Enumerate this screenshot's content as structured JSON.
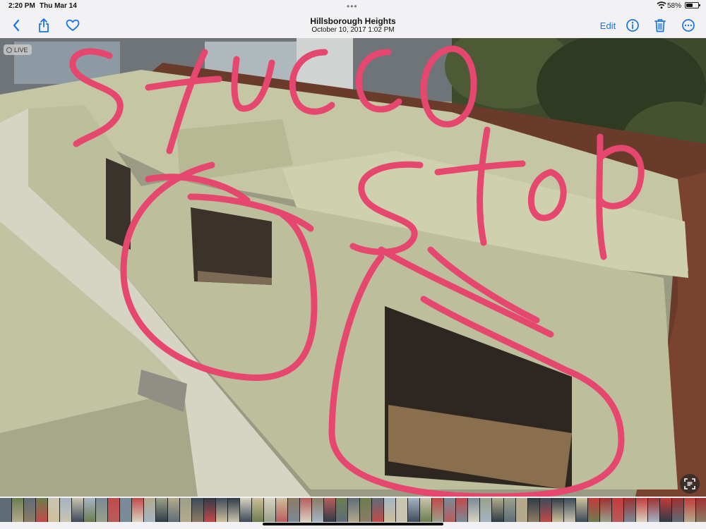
{
  "status_bar": {
    "time": "2:20 PM",
    "date": "Thu Mar 14",
    "battery_percent": "58%",
    "battery_level": 0.58
  },
  "nav": {
    "title": "Hillsborough Heights",
    "subtitle": "October 10, 2017  1:02 PM",
    "edit_label": "Edit",
    "accent_color": "#1a73e8"
  },
  "photo": {
    "live_label": "LIVE",
    "annotations": [
      "stucco",
      "stop"
    ],
    "annotation_color": "#e6476f"
  },
  "icons": {
    "back": "chevron-left-icon",
    "share": "share-icon",
    "favorite": "heart-icon",
    "info": "info-icon",
    "delete": "trash-icon",
    "more": "ellipsis-icon",
    "live_text": "live-text-scan-icon"
  }
}
